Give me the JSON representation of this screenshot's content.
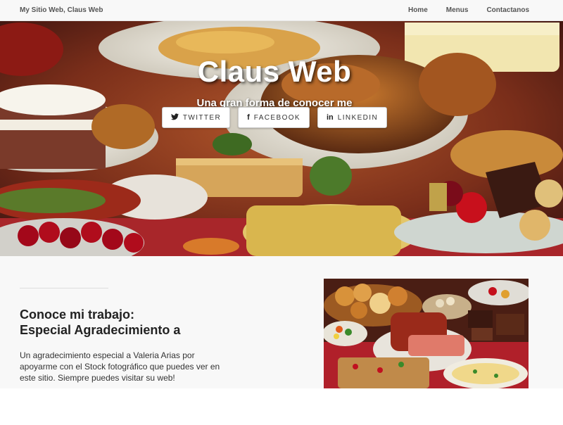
{
  "navbar": {
    "brand": "My Sitio Web, Claus Web",
    "links": [
      "Home",
      "Menus",
      "Contactanos"
    ]
  },
  "hero": {
    "title": "Claus Web",
    "subtitle": "Una gran forma de conocer me",
    "social": [
      {
        "icon": "twitter-icon",
        "glyph": "🐦",
        "label": "TWITTER"
      },
      {
        "icon": "facebook-icon",
        "glyph": "f",
        "label": "FACEBOOK"
      },
      {
        "icon": "linkedin-icon",
        "glyph": "in",
        "label": "LINKEDIN"
      }
    ]
  },
  "section": {
    "title_line1": "Conoce mi trabajo:",
    "title_line2": "Especial Agradecimiento a",
    "text": "Un agradecimiento especial a Valeria Arias por apoyarme con el Stock fotográfico que puedes ver en este sitio. Siempre puedes visitar su web!"
  },
  "colors": {
    "navbar_bg": "#f8f8f8",
    "content_bg": "#f8f8f8",
    "text": "#333333"
  }
}
